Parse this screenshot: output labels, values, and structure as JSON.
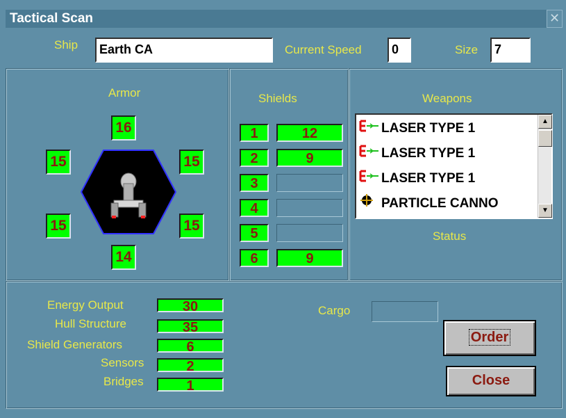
{
  "window": {
    "title": "Tactical Scan",
    "close_symbol": "✕"
  },
  "header": {
    "ship_label": "Ship",
    "ship_value": "Earth CA",
    "speed_label": "Current Speed",
    "speed_value": "0",
    "size_label": "Size",
    "size_value": "7"
  },
  "armor": {
    "label": "Armor",
    "top": "16",
    "upper_left": "15",
    "upper_right": "15",
    "lower_left": "15",
    "lower_right": "15",
    "bottom": "14"
  },
  "shields": {
    "label": "Shields",
    "rows": [
      {
        "num": "1",
        "value": "12"
      },
      {
        "num": "2",
        "value": "9"
      },
      {
        "num": "3",
        "value": ""
      },
      {
        "num": "4",
        "value": ""
      },
      {
        "num": "5",
        "value": ""
      },
      {
        "num": "6",
        "value": "9"
      }
    ]
  },
  "weapons": {
    "label": "Weapons",
    "items": [
      {
        "name": "LASER TYPE 1",
        "icon": "laser-icon"
      },
      {
        "name": "LASER TYPE 1",
        "icon": "laser-icon"
      },
      {
        "name": "LASER TYPE 1",
        "icon": "laser-icon"
      },
      {
        "name": "PARTICLE CANNO",
        "icon": "particle-cannon-icon"
      }
    ],
    "status_label": "Status"
  },
  "stats": {
    "energy_label": "Energy Output",
    "energy_value": "30",
    "hull_label": "Hull Structure",
    "hull_value": "35",
    "shieldgen_label": "Shield Generators",
    "shieldgen_value": "6",
    "sensors_label": "Sensors",
    "sensors_value": "2",
    "bridges_label": "Bridges",
    "bridges_value": "1"
  },
  "cargo": {
    "label": "Cargo",
    "value": ""
  },
  "buttons": {
    "order": "Order",
    "close": "Close"
  },
  "colors": {
    "background": "#5f8ea6",
    "label_yellow": "#e8e84a",
    "value_green": "#00ff00",
    "value_text": "#8b1a10",
    "hex_border": "#3030ff"
  }
}
